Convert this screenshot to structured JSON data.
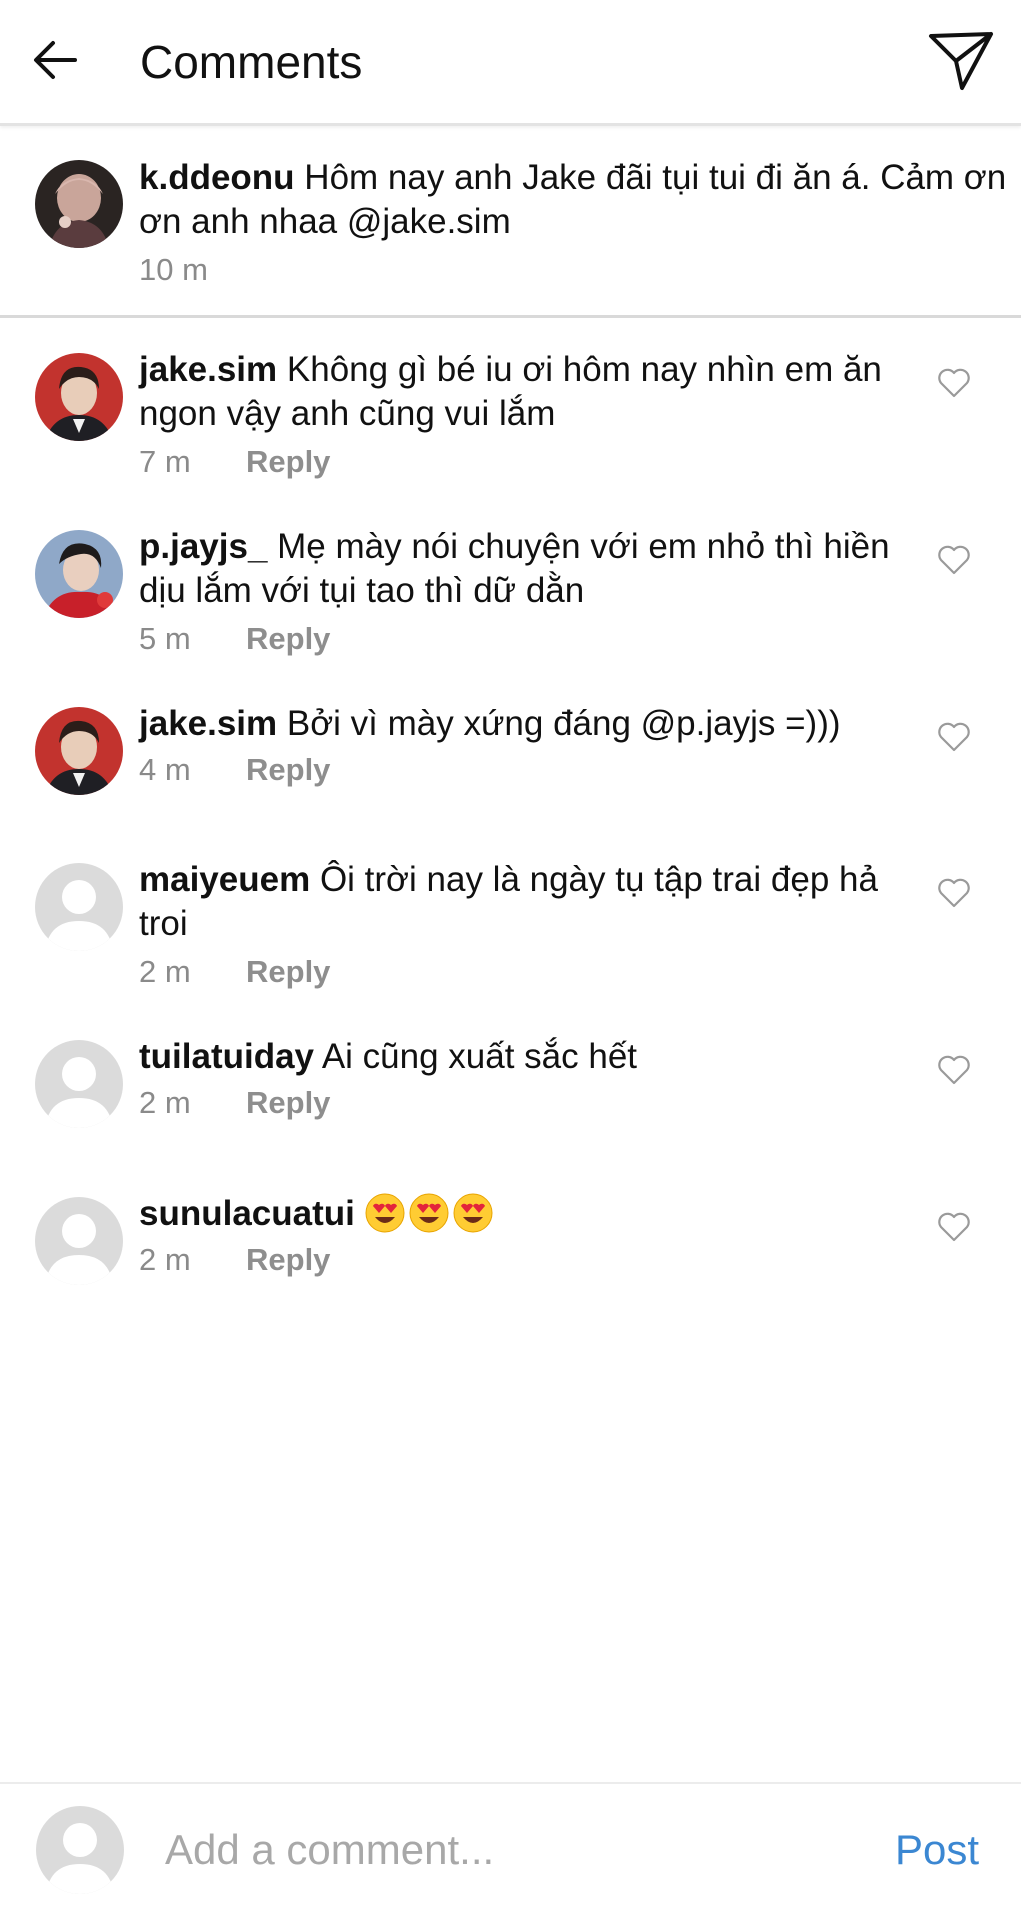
{
  "header": {
    "title": "Comments",
    "back_icon": "arrow-left-icon",
    "share_icon": "paper-plane-icon"
  },
  "caption": {
    "username": "k.ddeonu",
    "text": "Hôm nay anh Jake đãi tụi tui đi ăn á. Cảm ơn ơn anh nhaa @jake.sim",
    "time": "10 m"
  },
  "comments": [
    {
      "username": "jake.sim",
      "text": "Không gì bé iu ơi hôm nay nhìn em ăn ngon vậy anh cũng vui lắm",
      "time": "7 m",
      "reply": "Reply"
    },
    {
      "username": "p.jayjs_",
      "text": "Mẹ mày nói chuyện với em nhỏ thì hiền dịu lắm với tụi tao thì dữ dằn",
      "time": "5 m",
      "reply": "Reply"
    },
    {
      "username": "jake.sim",
      "text": "Bởi vì mày xứng đáng @p.jayjs =)))",
      "time": "4 m",
      "reply": "Reply"
    },
    {
      "username": "maiyeuem",
      "text": "Ôi trời nay là ngày tụ tập trai đẹp hả troi",
      "time": "2 m",
      "reply": "Reply"
    },
    {
      "username": "tuilatuiday",
      "text": "Ai cũng xuất sắc hết",
      "time": "2 m",
      "reply": "Reply"
    },
    {
      "username": "sunulacuatui",
      "text": "",
      "emoji": "heart-eyes-face-icon",
      "emoji_count": 3,
      "time": "2 m",
      "reply": "Reply"
    }
  ],
  "footer": {
    "placeholder": "Add a comment...",
    "post_label": "Post"
  },
  "colors": {
    "accent": "#3b87d2",
    "meta_text": "#8a8a8a",
    "divider": "#d9d9d9",
    "placeholder_avatar": "#dbdbdb"
  }
}
